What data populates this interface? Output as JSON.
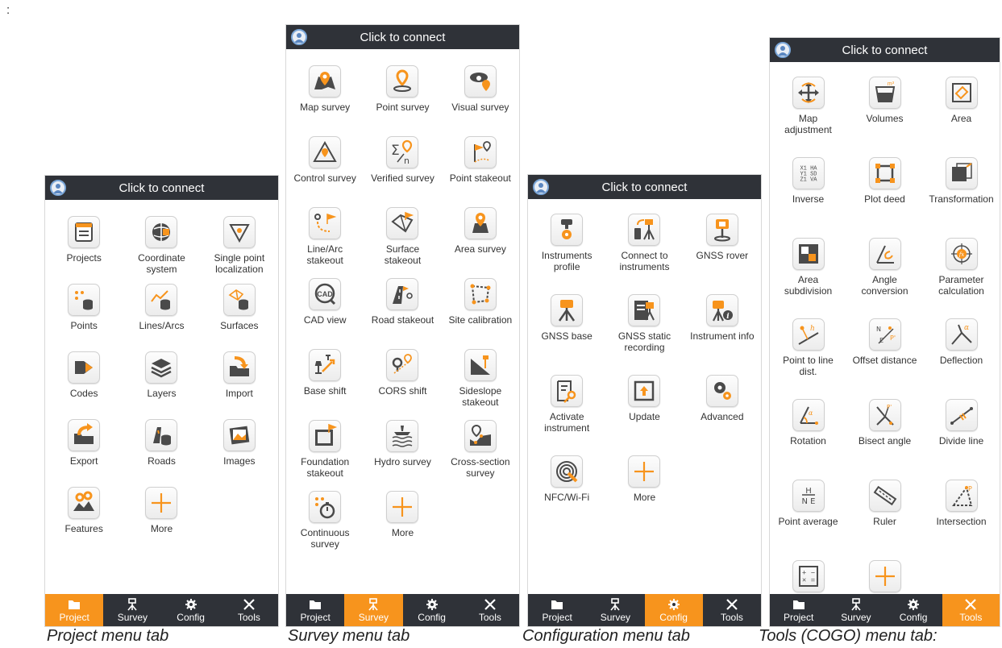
{
  "leading_text": ":",
  "colors": {
    "topbar": "#2f3238",
    "accent": "#f7941d",
    "icon_dark": "#4a4a4a"
  },
  "panels": [
    {
      "caption": "Project menu tab",
      "topbar_title": "Click to connect",
      "active_tab": "Project",
      "items": [
        {
          "label": "Projects",
          "icon": "projects-icon"
        },
        {
          "label": "Coordinate\nsystem",
          "icon": "globe-icon"
        },
        {
          "label": "Single point\nlocalization",
          "icon": "localization-icon"
        },
        {
          "label": "Points",
          "icon": "points-db-icon"
        },
        {
          "label": "Lines/Arcs",
          "icon": "lines-db-icon"
        },
        {
          "label": "Surfaces",
          "icon": "surfaces-db-icon"
        },
        {
          "label": "Codes",
          "icon": "tag-icon"
        },
        {
          "label": "Layers",
          "icon": "layers-icon"
        },
        {
          "label": "Import",
          "icon": "import-icon"
        },
        {
          "label": "Export",
          "icon": "export-icon"
        },
        {
          "label": "Roads",
          "icon": "roads-db-icon"
        },
        {
          "label": "Images",
          "icon": "images-icon"
        },
        {
          "label": "Features",
          "icon": "features-icon"
        },
        {
          "label": "More",
          "icon": "plus-icon"
        }
      ]
    },
    {
      "caption": "Survey menu tab",
      "topbar_title": "Click to connect",
      "active_tab": "Survey",
      "items": [
        {
          "label": "Map survey",
          "icon": "map-pin-icon"
        },
        {
          "label": "Point survey",
          "icon": "point-survey-icon"
        },
        {
          "label": "Visual survey",
          "icon": "camera-pin-icon"
        },
        {
          "label": "Control survey",
          "icon": "triangle-pin-icon"
        },
        {
          "label": "Verified survey",
          "icon": "sigma-icon"
        },
        {
          "label": "Point stakeout",
          "icon": "flag-pin-icon"
        },
        {
          "label": "Line/Arc\nstakeout",
          "icon": "line-stakeout-icon"
        },
        {
          "label": "Surface\nstakeout",
          "icon": "surface-stakeout-icon"
        },
        {
          "label": "Area survey",
          "icon": "area-survey-icon"
        },
        {
          "label": "CAD view",
          "icon": "cad-icon"
        },
        {
          "label": "Road stakeout",
          "icon": "road-stakeout-icon"
        },
        {
          "label": "Site calibration",
          "icon": "site-calibration-icon"
        },
        {
          "label": "Base shift",
          "icon": "base-shift-icon"
        },
        {
          "label": "CORS shift",
          "icon": "cors-shift-icon"
        },
        {
          "label": "Sideslope\nstakeout",
          "icon": "sideslope-icon"
        },
        {
          "label": "Foundation\nstakeout",
          "icon": "foundation-icon"
        },
        {
          "label": "Hydro survey",
          "icon": "hydro-icon"
        },
        {
          "label": "Cross-section\nsurvey",
          "icon": "cross-section-icon"
        },
        {
          "label": "Continuous\nsurvey",
          "icon": "stopwatch-icon"
        },
        {
          "label": "More",
          "icon": "plus-icon"
        }
      ]
    },
    {
      "caption": "Configuration menu tab",
      "topbar_title": "Click to connect",
      "active_tab": "Config",
      "items": [
        {
          "label": "Instruments\nprofile",
          "icon": "instrument-profile-icon"
        },
        {
          "label": "Connect to\ninstruments",
          "icon": "connect-instrument-icon"
        },
        {
          "label": "GNSS rover",
          "icon": "gnss-rover-icon"
        },
        {
          "label": "GNSS base",
          "icon": "gnss-base-icon"
        },
        {
          "label": "GNSS static\nrecording",
          "icon": "static-recording-icon"
        },
        {
          "label": "Instrument info",
          "icon": "instrument-info-icon"
        },
        {
          "label": "Activate\ninstrument",
          "icon": "activate-icon"
        },
        {
          "label": "Update",
          "icon": "update-icon"
        },
        {
          "label": "Advanced",
          "icon": "gears-icon"
        },
        {
          "label": "NFC/Wi-Fi",
          "icon": "nfc-icon"
        },
        {
          "label": "More",
          "icon": "plus-icon"
        }
      ]
    },
    {
      "caption": "Tools (COGO) menu tab:",
      "topbar_title": "Click to connect",
      "active_tab": "Tools",
      "items": [
        {
          "label": "Map\nadjustment",
          "icon": "map-adjust-icon"
        },
        {
          "label": "Volumes",
          "icon": "volumes-icon"
        },
        {
          "label": "Area",
          "icon": "area-icon"
        },
        {
          "label": "Inverse",
          "icon": "inverse-icon",
          "glyph": "X1  HA\nY1  SD\nZ1  VA"
        },
        {
          "label": "Plot deed",
          "icon": "plot-deed-icon"
        },
        {
          "label": "Transformation",
          "icon": "transformation-icon"
        },
        {
          "label": "Area\nsubdivision",
          "icon": "area-subdivision-icon"
        },
        {
          "label": "Angle\nconversion",
          "icon": "angle-conversion-icon"
        },
        {
          "label": "Parameter\ncalculation",
          "icon": "parameter-icon"
        },
        {
          "label": "Point to line\ndist.",
          "icon": "point-line-icon"
        },
        {
          "label": "Offset distance",
          "icon": "offset-icon",
          "glyph": "N  P\nE  P'"
        },
        {
          "label": "Deflection",
          "icon": "deflection-icon"
        },
        {
          "label": "Rotation",
          "icon": "rotation-icon"
        },
        {
          "label": "Bisect angle",
          "icon": "bisect-icon"
        },
        {
          "label": "Divide line",
          "icon": "divide-line-icon"
        },
        {
          "label": "Point average",
          "icon": "point-average-icon",
          "glyph": "H\nN E"
        },
        {
          "label": "Ruler",
          "icon": "ruler-icon"
        },
        {
          "label": "Intersection",
          "icon": "intersection-icon",
          "glyph": "P"
        },
        {
          "label": "Calculator",
          "icon": "calculator-icon",
          "glyph": "+ −\n× ="
        },
        {
          "label": "More",
          "icon": "plus-icon"
        }
      ]
    }
  ],
  "tabs": [
    {
      "label": "Project",
      "icon": "folder-icon"
    },
    {
      "label": "Survey",
      "icon": "survey-icon"
    },
    {
      "label": "Config",
      "icon": "gear-icon"
    },
    {
      "label": "Tools",
      "icon": "tools-icon"
    }
  ]
}
